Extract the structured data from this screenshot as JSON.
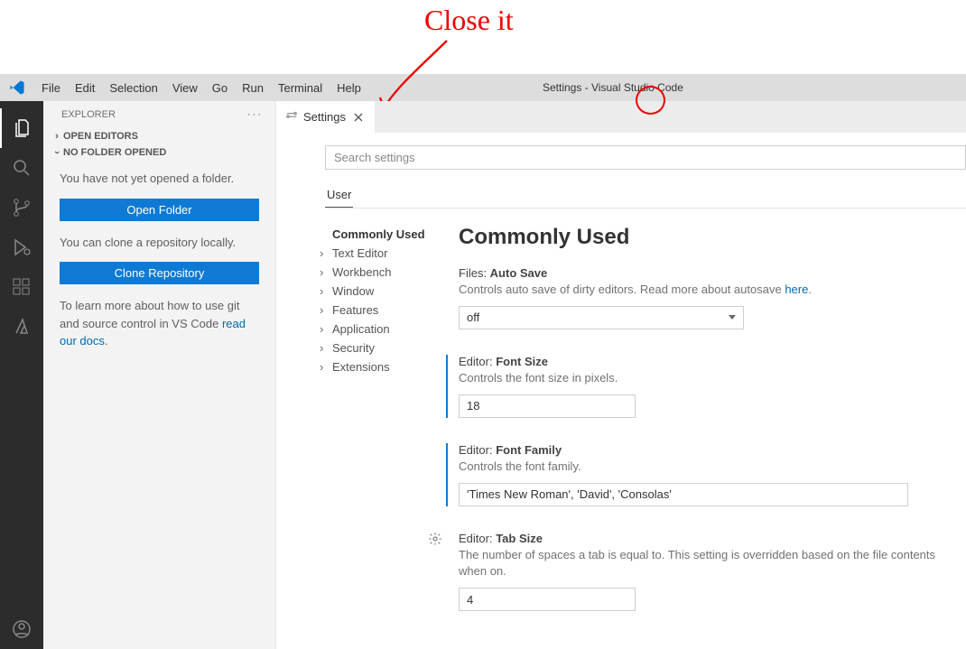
{
  "annotation": {
    "text": "Close it"
  },
  "menubar": {
    "items": [
      "File",
      "Edit",
      "Selection",
      "View",
      "Go",
      "Run",
      "Terminal",
      "Help"
    ],
    "title": "Settings - Visual Studio Code"
  },
  "activitybar": {
    "items": [
      "explorer",
      "search",
      "source-control",
      "run-debug",
      "extensions",
      "azure"
    ]
  },
  "sidebar": {
    "title": "EXPLORER",
    "sections": {
      "open_editors": "OPEN EDITORS",
      "no_folder": "NO FOLDER OPENED"
    },
    "body": {
      "p1": "You have not yet opened a folder.",
      "btn_open": "Open Folder",
      "p2": "You can clone a repository locally.",
      "btn_clone": "Clone Repository",
      "p3a": "To learn more about how to use git and source control in VS Code ",
      "p3_link": "read our docs",
      "p3b": "."
    }
  },
  "tabs": {
    "settings": "Settings"
  },
  "search": {
    "placeholder": "Search settings"
  },
  "scope": {
    "user": "User"
  },
  "toc": {
    "commonly_used": "Commonly Used",
    "text_editor": "Text Editor",
    "workbench": "Workbench",
    "window": "Window",
    "features": "Features",
    "application": "Application",
    "security": "Security",
    "extensions": "Extensions"
  },
  "settings": {
    "heading": "Commonly Used",
    "autosave": {
      "cat": "Files: ",
      "name": "Auto Save",
      "desc_a": "Controls auto save of dirty editors. Read more about autosave ",
      "desc_link": "here",
      "desc_b": ".",
      "value": "off"
    },
    "fontsize": {
      "cat": "Editor: ",
      "name": "Font Size",
      "desc": "Controls the font size in pixels.",
      "value": "18"
    },
    "fontfamily": {
      "cat": "Editor: ",
      "name": "Font Family",
      "desc": "Controls the font family.",
      "value": "'Times New Roman', 'David', 'Consolas'"
    },
    "tabsize": {
      "cat": "Editor: ",
      "name": "Tab Size",
      "desc": "The number of spaces a tab is equal to. This setting is overridden based on the file contents when  on.",
      "value": "4"
    }
  }
}
